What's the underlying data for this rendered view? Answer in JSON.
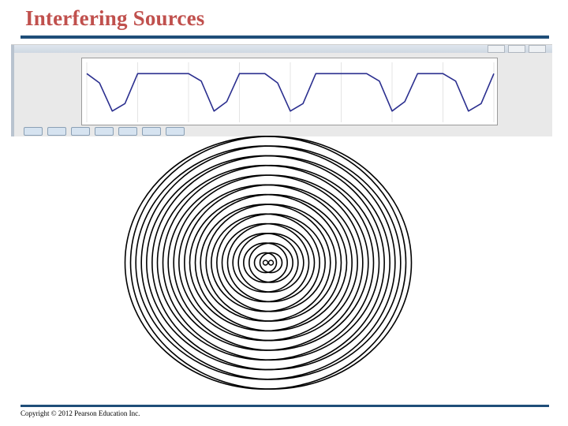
{
  "slide": {
    "title": "Interfering Sources",
    "copyright": "Copyright © 2012 Pearson Education Inc."
  },
  "colors": {
    "title": "#c0504d",
    "rule": "#1f4e79",
    "wave": "#2b2f8f",
    "rings": "#000000"
  },
  "wave_plot": {
    "type": "line",
    "description_of_shape": "flat-topped wave with rounded troughs",
    "x": [
      0,
      0.5,
      1,
      1.5,
      2,
      2.5,
      3,
      3.5,
      4,
      4.5,
      5,
      5.5,
      6,
      6.5,
      7,
      7.5,
      8,
      8.5,
      9,
      9.5,
      10,
      10.5,
      11,
      11.5,
      12,
      12.5,
      13,
      13.5,
      14,
      14.5,
      15,
      15.5,
      16
    ],
    "y": [
      1,
      0.5,
      -1,
      -0.6,
      1,
      1,
      1,
      1,
      1,
      0.6,
      -1,
      -0.5,
      1,
      1,
      1,
      0.5,
      -1,
      -0.6,
      1,
      1,
      1,
      1,
      1,
      0.6,
      -1,
      -0.5,
      1,
      1,
      1,
      0.6,
      -1,
      -0.6,
      1
    ],
    "xlim": [
      0,
      16
    ],
    "ylim": [
      -1.6,
      1.6
    ]
  },
  "rings": {
    "ring_count": 13,
    "source_count": 2
  }
}
